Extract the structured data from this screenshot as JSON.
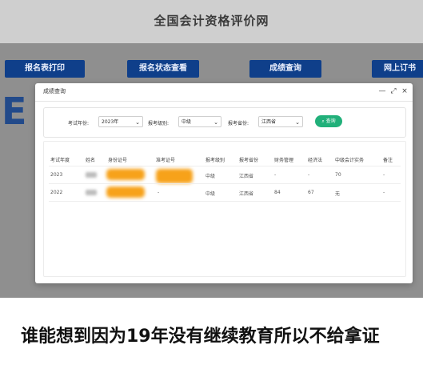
{
  "site": {
    "title": "全国会计资格评价网",
    "nav": [
      "报名表打印",
      "报名状态查看",
      "成绩查询",
      "网上订书"
    ]
  },
  "dialog": {
    "title": "成绩查询",
    "controls": {
      "minimize": "—",
      "maximize": "⤢",
      "close": "×"
    },
    "filters": {
      "year_label": "考试年份:",
      "year_value": "2023年",
      "level_label": "报考级别:",
      "level_value": "中级",
      "province_label": "报考省份:",
      "province_value": "江西省",
      "query_button": "查询"
    },
    "table": {
      "columns": [
        "考试年度",
        "姓名",
        "身份证号",
        "准考证号",
        "报考级别",
        "报考省份",
        "财务管理",
        "经济法",
        "中级会计实务",
        "备注"
      ],
      "rows": [
        [
          "2023",
          "",
          "",
          "",
          "中级",
          "江西省",
          "-",
          "-",
          "70",
          "-"
        ],
        [
          "2022",
          "",
          "",
          "-",
          "中级",
          "江西省",
          "84",
          "67",
          "无",
          "-"
        ]
      ]
    }
  },
  "caption": "谁能想到因为19年没有继续教育所以不给拿证",
  "colors": {
    "nav_blue": "#0f3f8a",
    "query_green": "#21b07a",
    "redaction_orange": "#f7a21a"
  },
  "icons": {
    "query": "search-icon"
  }
}
